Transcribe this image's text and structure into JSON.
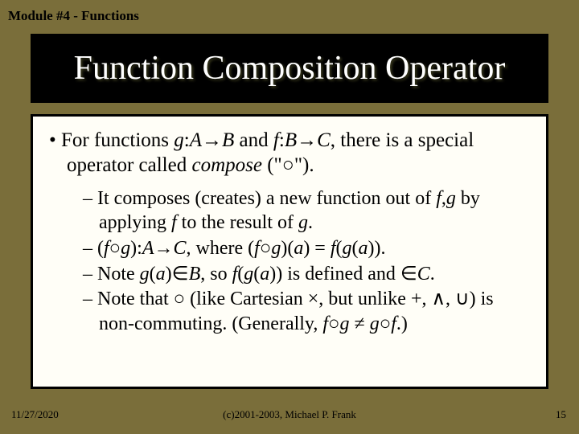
{
  "header": {
    "module": "Module #4 - Functions"
  },
  "title": "Function Composition Operator",
  "main_bullet": {
    "prefix": "• For functions ",
    "g": "g",
    "colon1": ":",
    "A": "A",
    "arrow1": "→",
    "B1": "B",
    "and": " and ",
    "f": "f",
    "colon2": ":",
    "B2": "B",
    "arrow2": "→",
    "C": "C",
    "rest": ", there is a special operator called ",
    "compose": "compose",
    "tail": " (\"○\")."
  },
  "subs": {
    "s1a": "– It composes (creates) a new function out of ",
    "s1_f": "f",
    "s1_comma": ",",
    "s1_g": "g",
    "s1b": " by applying ",
    "s1_f2": "f",
    "s1c": " to the result of ",
    "s1_g2": "g",
    "s1d": ".",
    "s2a": "– (",
    "s2_f": "f",
    "s2_circ1": "○",
    "s2_g": "g",
    "s2b": "):",
    "s2_A": "A",
    "s2_arrow": "→",
    "s2_C": "C",
    "s2c": ", where (",
    "s2_f2": "f",
    "s2_circ2": "○",
    "s2_g2": "g",
    "s2d": ")(",
    "s2_a1": "a",
    "s2e": ") = ",
    "s2_f3": "f",
    "s2f": "(",
    "s2_g3": "g",
    "s2g": "(",
    "s2_a2": "a",
    "s2h": ")).",
    "s3a": "– Note ",
    "s3_g": "g",
    "s3b": "(",
    "s3_a": "a",
    "s3c": ")∈",
    "s3_B": "B",
    "s3d": ", so ",
    "s3_f": "f",
    "s3e": "(",
    "s3_g2": "g",
    "s3f": "(",
    "s3_a2": "a",
    "s3g": ")) is defined and ∈",
    "s3_C": "C",
    "s3h": ".",
    "s4a": "– Note that ○ (like Cartesian ×, but unlike +, ∧, ∪) is non-commuting. (Generally, ",
    "s4_f": "f",
    "s4_circ1": "○",
    "s4_g": "g",
    "s4_neq": " ≠ ",
    "s4_g2": "g",
    "s4_circ2": "○",
    "s4_f2": "f",
    "s4b": ".)"
  },
  "footer": {
    "date": "11/27/2020",
    "copyright": "(c)2001-2003, Michael P. Frank",
    "page": "15"
  }
}
